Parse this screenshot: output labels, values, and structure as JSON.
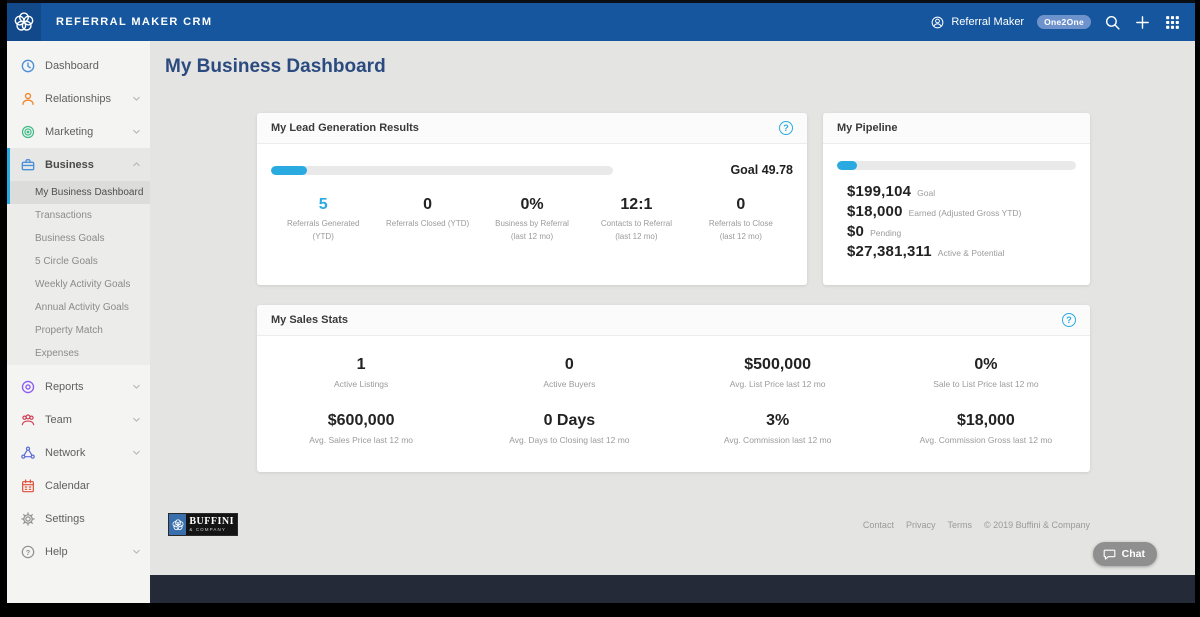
{
  "topbar": {
    "brand": "REFERRAL MAKER CRM",
    "user_label": "Referral Maker",
    "badge": "One2One"
  },
  "page": {
    "title": "My Business Dashboard"
  },
  "icons": {
    "question": "?"
  },
  "sidebar": {
    "items": [
      {
        "label": "Dashboard"
      },
      {
        "label": "Relationships"
      },
      {
        "label": "Marketing"
      },
      {
        "label": "Business"
      },
      {
        "label": "Reports"
      },
      {
        "label": "Team"
      },
      {
        "label": "Network"
      },
      {
        "label": "Calendar"
      },
      {
        "label": "Settings"
      },
      {
        "label": "Help"
      }
    ],
    "sub": [
      "My Business Dashboard",
      "Transactions",
      "Business Goals",
      "5 Circle Goals",
      "Weekly Activity Goals",
      "Annual Activity Goals",
      "Property Match",
      "Expenses"
    ]
  },
  "lead": {
    "title": "My Lead Generation Results",
    "goal": "Goal 49.78",
    "progress_pct": 10.5,
    "stats": [
      {
        "value": "5",
        "label": "Referrals Generated",
        "sublabel": "(YTD)"
      },
      {
        "value": "0",
        "label": "Referrals Closed (YTD)",
        "sublabel": ""
      },
      {
        "value": "0%",
        "label": "Business by Referral",
        "sublabel": "(last 12 mo)"
      },
      {
        "value": "12:1",
        "label": "Contacts to Referral",
        "sublabel": "(last 12 mo)"
      },
      {
        "value": "0",
        "label": "Referrals to Close",
        "sublabel": "(last 12 mo)"
      }
    ]
  },
  "pipeline": {
    "title": "My Pipeline",
    "progress_pct": 8.5,
    "rows": [
      {
        "value": "$199,104",
        "label": "Goal"
      },
      {
        "value": "$18,000",
        "label": "Earned (Adjusted Gross YTD)"
      },
      {
        "value": "$0",
        "label": "Pending"
      },
      {
        "value": "$27,381,311",
        "label": "Active & Potential"
      }
    ]
  },
  "sales": {
    "title": "My Sales Stats",
    "row1": [
      {
        "value": "1",
        "label": "Active Listings"
      },
      {
        "value": "0",
        "label": "Active Buyers"
      },
      {
        "value": "$500,000",
        "label": "Avg. List Price last 12 mo"
      },
      {
        "value": "0%",
        "label": "Sale to List Price last 12 mo"
      }
    ],
    "row2": [
      {
        "value": "$600,000",
        "label": "Avg. Sales Price last 12 mo"
      },
      {
        "value": "0 Days",
        "label": "Avg. Days to Closing last 12 mo"
      },
      {
        "value": "3%",
        "label": "Avg. Commission last 12 mo"
      },
      {
        "value": "$18,000",
        "label": "Avg. Commission Gross last 12 mo"
      }
    ]
  },
  "footer": {
    "logo_line1": "BUFFINI",
    "logo_line2": "& COMPANY",
    "links": [
      "Contact",
      "Privacy",
      "Terms"
    ],
    "copyright": "© 2019 Buffini & Company",
    "chat_label": "Chat"
  }
}
